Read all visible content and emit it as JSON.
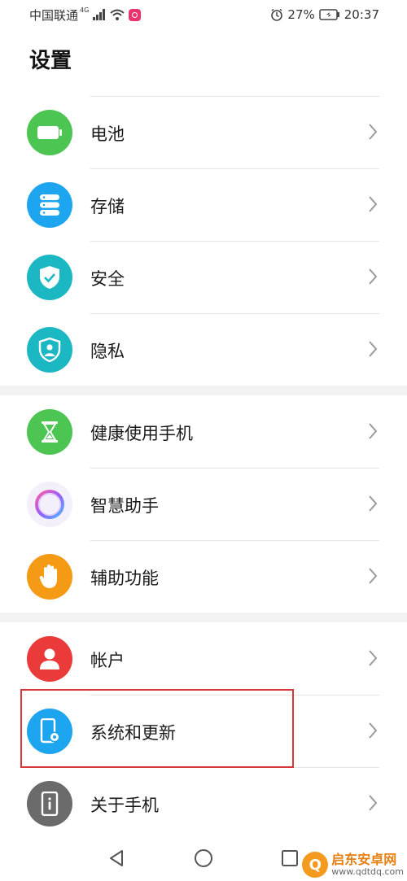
{
  "status_bar": {
    "carrier": "中国联通",
    "network": "4G",
    "battery_percent": "27%",
    "time": "20:37"
  },
  "title": "设置",
  "groups": [
    [
      {
        "label": "电池",
        "icon": "battery-icon",
        "color": "#4cc552"
      },
      {
        "label": "存储",
        "icon": "storage-icon",
        "color": "#1ea5f0"
      },
      {
        "label": "安全",
        "icon": "shield-check-icon",
        "color": "#1bb8c4"
      },
      {
        "label": "隐私",
        "icon": "privacy-icon",
        "color": "#1bb8c4"
      }
    ],
    [
      {
        "label": "健康使用手机",
        "icon": "hourglass-icon",
        "color": "#4cc552"
      },
      {
        "label": "智慧助手",
        "icon": "assistant-ring-icon",
        "color": "#f3f0fb"
      },
      {
        "label": "辅助功能",
        "icon": "hand-icon",
        "color": "#f59a14"
      }
    ],
    [
      {
        "label": "帐户",
        "icon": "account-icon",
        "color": "#ea3a3a"
      },
      {
        "label": "系统和更新",
        "icon": "phone-settings-icon",
        "color": "#1ea5f0"
      },
      {
        "label": "关于手机",
        "icon": "about-phone-icon",
        "color": "#6b6b6b"
      }
    ]
  ],
  "watermark": {
    "name": "启东安卓网",
    "url": "www.qdtdq.com"
  }
}
